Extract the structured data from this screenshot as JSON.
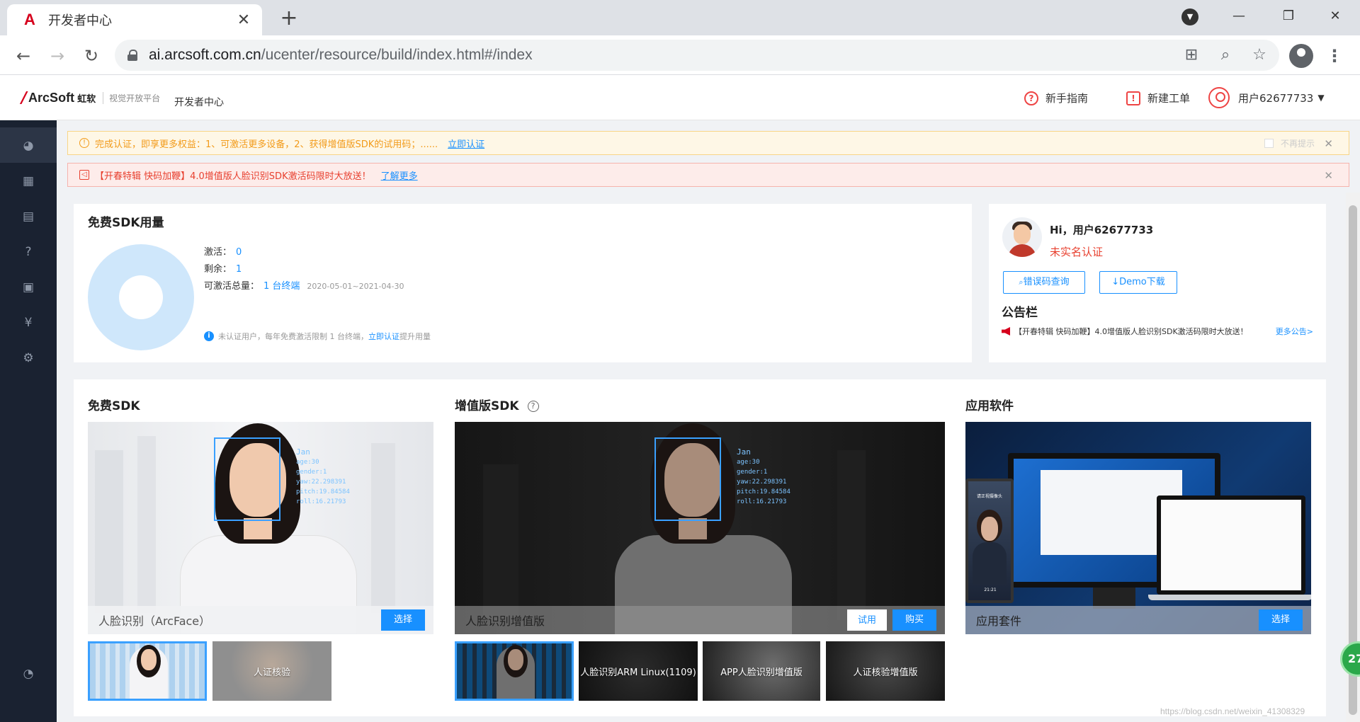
{
  "browser": {
    "tab_title": "开发者中心",
    "tab_favicon": "A",
    "url_host": "ai.arcsoft.com.cn",
    "url_path": "/ucenter/resource/build/index.html#/index"
  },
  "header": {
    "brand": "ArcSoft",
    "brand_cn": "虹软",
    "platform": "视觉开放平台",
    "dev_center": "开发者中心",
    "guide": "新手指南",
    "new_ticket": "新建工单",
    "user": "用户62677733"
  },
  "notices": {
    "auth_text": "完成认证，即享更多权益：1、可激活更多设备，2、获得增值版SDK的试用码；......",
    "auth_link": "立即认证",
    "no_more": "不再提示",
    "promo_text": "【开春特辑 快码加鞭】4.0增值版人脸识别SDK激活码限时大放送！",
    "promo_link": "了解更多"
  },
  "usage": {
    "title": "免费SDK用量",
    "activated_label": "激活：",
    "activated_value": "0",
    "remaining_label": "剩余：",
    "remaining_value": "1",
    "total_label": "可激活总量：",
    "total_value": "1 台终端",
    "total_period": "2020-05-01~2021-04-30",
    "tip_prefix": "未认证用户，每年免费激活限制 1 台终端，",
    "tip_link": "立即认证",
    "tip_suffix": "提升用量"
  },
  "profile": {
    "greeting": "Hi，用户62677733",
    "status": "未实名认证",
    "btn_error": "错误码查询",
    "btn_demo": "Demo下载",
    "board_title": "公告栏",
    "board_item": "【开春特辑 快码加鞭】4.0增值版人脸识别SDK激活码限时大放送！",
    "board_more": "更多公告>"
  },
  "free_sdk": {
    "title": "免费SDK",
    "hero_label": "人脸识别（ArcFace）",
    "select": "选择",
    "thumb2": "人证核验",
    "scan": [
      "Jan",
      "age:30",
      "gender:1",
      "yaw:22.298391",
      "pitch:19.84584",
      "roll:16.21793"
    ]
  },
  "pro_sdk": {
    "title": "增值版SDK",
    "hero_label": "人脸识别增值版",
    "trial": "试用",
    "buy": "购买",
    "thumb2": "人脸识别ARM Linux(1109)",
    "thumb3": "APP人脸识别增值版",
    "thumb4": "人证核验增值版"
  },
  "apps": {
    "title": "应用软件",
    "hero_label": "应用套件",
    "select": "选择",
    "kiosk_text": "请正视摄像头",
    "kiosk_time": "21:21"
  },
  "watermark": "https://blog.csdn.net/weixin_41308329",
  "bubble": "27",
  "colors": {
    "accent": "#1890ff",
    "brand_red": "#d6001c",
    "sidebar": "#1a2231",
    "warn": "#f29b1a",
    "danger": "#e8402f"
  }
}
